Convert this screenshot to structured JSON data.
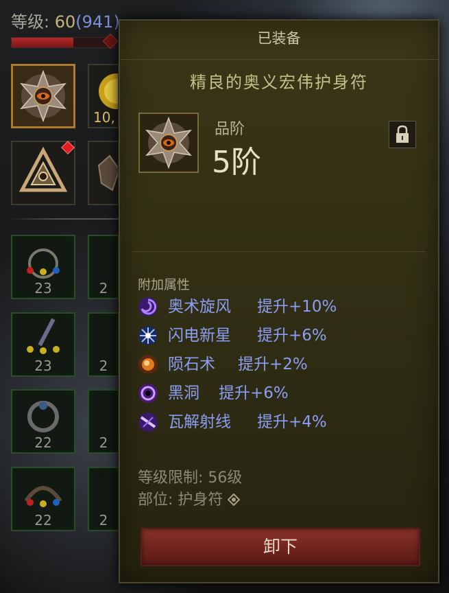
{
  "character": {
    "level_label": "等级: ",
    "level": "60",
    "paragon": "(941)",
    "xp_fraction": 0.6
  },
  "slots": {
    "gold_count": "10,",
    "skill_ranks": [
      "23",
      "2",
      "23",
      "2",
      "22",
      "2",
      "22",
      "2"
    ]
  },
  "tooltip": {
    "header": "已装备",
    "item_name": "精良的奥义宏伟护身符",
    "grade_label": "品阶",
    "grade_value": "5阶",
    "attributes_title": "附加属性",
    "affixes": [
      {
        "icon": "arcane-vortex-icon",
        "name": "奥术旋风",
        "bonus": "提升+10%"
      },
      {
        "icon": "lightning-nova-icon",
        "name": "闪电新星",
        "bonus": "提升+6%"
      },
      {
        "icon": "meteor-icon",
        "name": "陨石术",
        "bonus": "提升+2%"
      },
      {
        "icon": "black-hole-icon",
        "name": "黑洞",
        "bonus": "提升+6%"
      },
      {
        "icon": "disintegrate-icon",
        "name": "瓦解射线",
        "bonus": "提升+4%"
      }
    ],
    "level_requirement": "等级限制: 56级",
    "slot_type": "部位: 护身符",
    "unequip_label": "卸下"
  },
  "colors": {
    "affix_text": "#8c9ef2",
    "panel_bg": "#343114",
    "unequip_button": "#7a2a22",
    "item_name": "#c8c08c"
  }
}
